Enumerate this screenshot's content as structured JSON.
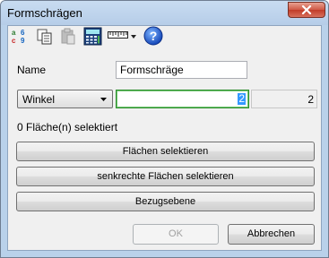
{
  "window": {
    "title": "Formschrägen"
  },
  "toolbar": {
    "icons": [
      "abc-table-icon",
      "copy-icon",
      "paste-icon",
      "calculator-icon",
      "ruler-icon",
      "help-icon"
    ]
  },
  "form": {
    "name_label": "Name",
    "name_value": "Formschräge",
    "mode_selected": "Winkel",
    "value_selected_text": "2",
    "readonly_value": "2",
    "selection_status": "0 Fläche(n) selektiert"
  },
  "buttons": {
    "select_faces": "Flächen selektieren",
    "select_vertical_faces": "senkrechte Flächen selektieren",
    "reference_plane": "Bezugsebene",
    "ok": "OK",
    "cancel": "Abbrechen"
  },
  "colors": {
    "client_bg": "#f0f0f0",
    "focus_border": "#2d8e2d",
    "selection": "#3399ff",
    "close_button": "#c13c28"
  }
}
